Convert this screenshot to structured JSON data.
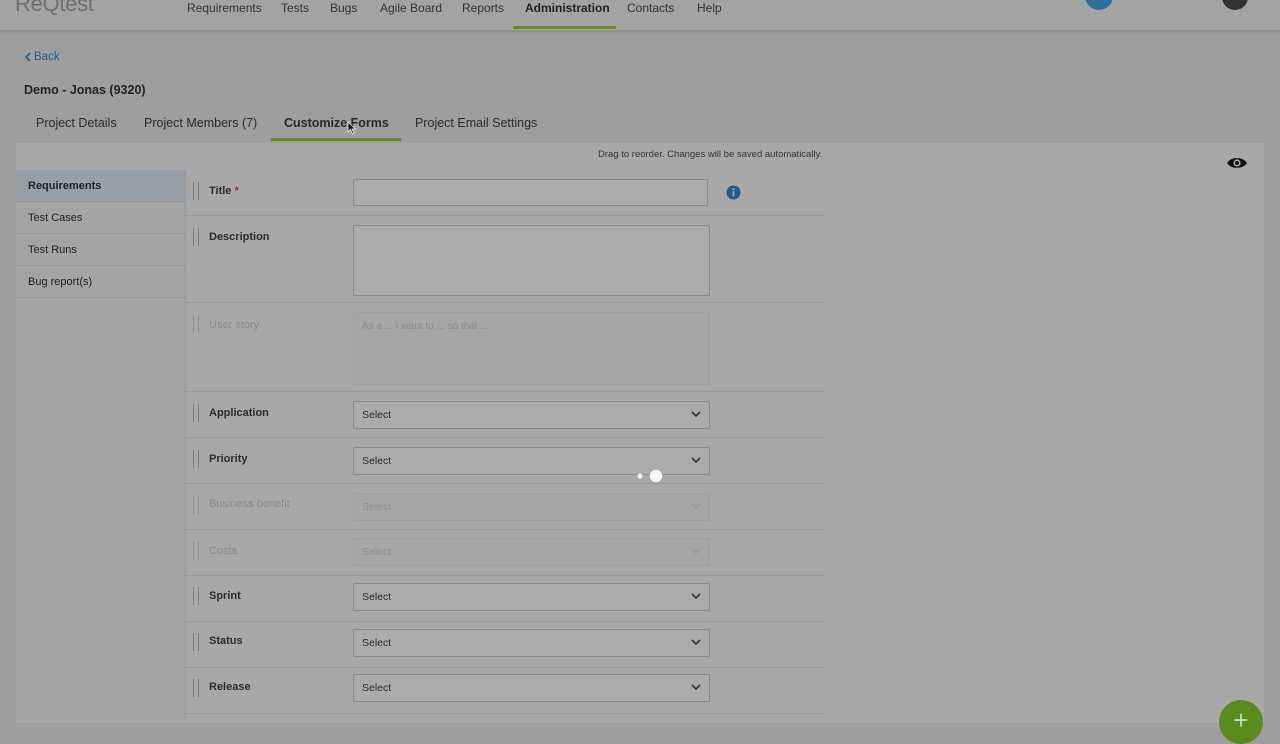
{
  "app": {
    "logo": "ReQtest"
  },
  "top_nav": [
    {
      "label": "Requirements",
      "active": false
    },
    {
      "label": "Tests",
      "active": false
    },
    {
      "label": "Bugs",
      "active": false
    },
    {
      "label": "Agile Board",
      "active": false
    },
    {
      "label": "Reports",
      "active": false
    },
    {
      "label": "Administration",
      "active": true
    },
    {
      "label": "Contacts",
      "active": false
    },
    {
      "label": "Help",
      "active": false
    }
  ],
  "back_label": "Back",
  "project_title": "Demo - Jonas (9320)",
  "tabs": [
    {
      "label": "Project Details"
    },
    {
      "label": "Project Members (7)"
    },
    {
      "label": "Customize Forms",
      "active": true
    },
    {
      "label": "Project Email Settings"
    }
  ],
  "hint": "Drag to reorder. Changes will be saved automatically.",
  "sidebar": [
    {
      "label": "Requirements",
      "active": true
    },
    {
      "label": "Test Cases"
    },
    {
      "label": "Test Runs"
    },
    {
      "label": "Bug report(s)"
    }
  ],
  "fields": {
    "title": {
      "label": "Title",
      "required_mark": "*"
    },
    "description": {
      "label": "Description"
    },
    "user_story": {
      "label": "User story",
      "placeholder": "As a ... I want to ... so that ..."
    },
    "application": {
      "label": "Application",
      "value": "Select"
    },
    "priority": {
      "label": "Priority",
      "value": "Select"
    },
    "business_benefit": {
      "label": "Business benefit",
      "value": "Select"
    },
    "costs": {
      "label": "Costs",
      "value": "Select"
    },
    "sprint": {
      "label": "Sprint",
      "value": "Select"
    },
    "status": {
      "label": "Status",
      "value": "Select"
    },
    "release": {
      "label": "Release",
      "value": "Select"
    }
  },
  "fab_label": "+",
  "colors": {
    "accent": "#6b8c24",
    "link": "#1f5c89",
    "info": "#1f5c89",
    "fab": "#5b8a1e"
  },
  "icons": [
    "eye-icon",
    "info-icon",
    "chevron-down-icon",
    "chevron-left-icon",
    "loading-spinner-icon",
    "plus-icon",
    "mouse-cursor-icon"
  ]
}
